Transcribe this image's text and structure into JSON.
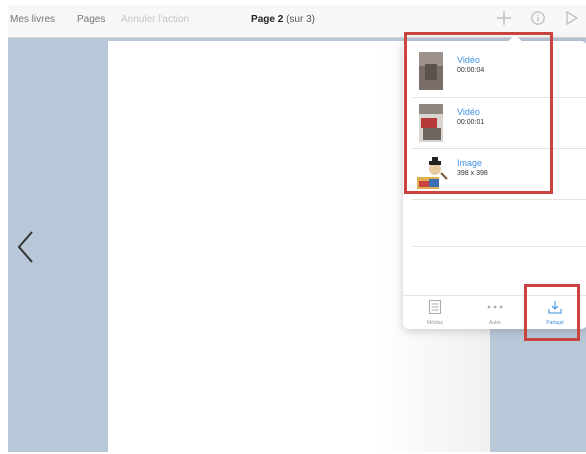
{
  "toolbar": {
    "my_books": "Mes livres",
    "pages": "Pages",
    "undo": "Annuler l'action",
    "page_title": "Page 2",
    "page_sub": "(sur 3)",
    "add_icon": "plus-icon",
    "info_icon": "info-icon",
    "play_icon": "play-icon"
  },
  "nav": {
    "prev_icon": "chevron-left-icon"
  },
  "popover": {
    "items": [
      {
        "title": "Vidéo",
        "subtitle": "00:00:04",
        "thumb_icon": "video-thumbnail"
      },
      {
        "title": "Vidéo",
        "subtitle": "00:00:01",
        "thumb_icon": "video-thumbnail"
      },
      {
        "title": "Image",
        "subtitle": "398 x 398",
        "thumb_icon": "image-thumbnail"
      }
    ],
    "tabs": [
      {
        "label": "Médias",
        "icon": "media-list-icon",
        "active": false
      },
      {
        "label": "Autre",
        "icon": "more-icon",
        "active": false
      },
      {
        "label": "Partagé",
        "icon": "download-tray-icon",
        "active": true
      }
    ]
  },
  "colors": {
    "accent": "#3d8fe0",
    "highlight": "#c9443e",
    "background": "#b9c8d9",
    "toolbar": "#f7f7f7"
  }
}
